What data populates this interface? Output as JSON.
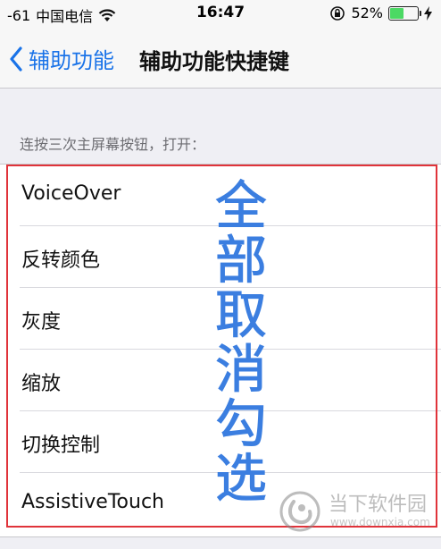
{
  "status_bar": {
    "signal": "-61",
    "carrier": "中国电信",
    "time": "16:47",
    "battery_percent": "52%",
    "battery_level": 0.52
  },
  "nav": {
    "back_label": "辅助功能",
    "title": "辅助功能快捷键"
  },
  "section": {
    "header": "连按三次主屏幕按钮，打开："
  },
  "options": [
    {
      "label": "VoiceOver"
    },
    {
      "label": "反转颜色"
    },
    {
      "label": "灰度"
    },
    {
      "label": "缩放"
    },
    {
      "label": "切换控制"
    },
    {
      "label": "AssistiveTouch"
    }
  ],
  "annotation": {
    "chars": [
      "全",
      "部",
      "取",
      "消",
      "勾",
      "选"
    ]
  },
  "watermark": {
    "brand": "当下软件园",
    "url": "www.downxia.com"
  },
  "colors": {
    "accent": "#1a73e8",
    "annotation_box": "#e0333a",
    "annotation_text": "#3b7ee0",
    "battery": "#4cd964"
  }
}
